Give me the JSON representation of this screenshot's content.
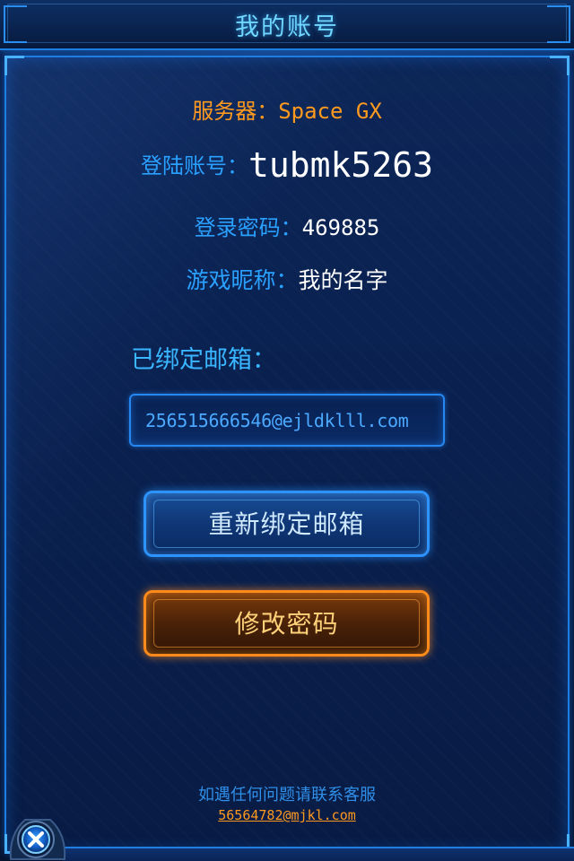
{
  "header": {
    "title": "我的账号"
  },
  "info": {
    "server_label": "服务器：",
    "server_value": "Space GX",
    "account_label": "登陆账号：",
    "account_value": "tubmk5263",
    "password_label": "登录密码：",
    "password_value": "469885",
    "nickname_label": "游戏昵称：",
    "nickname_value": "我的名字"
  },
  "email": {
    "label": "已绑定邮箱：",
    "value": "256515666546@ejldklll.com"
  },
  "buttons": {
    "rebind_label": "重新绑定邮箱",
    "change_password_label": "修改密码"
  },
  "footer": {
    "help_text": "如遇任何问题请联系客服",
    "service_email": "56564782@mjkl.com"
  },
  "icons": {
    "close": "close-x-icon"
  },
  "colors": {
    "accent_blue": "#2aa0ff",
    "accent_orange": "#ff9a1f",
    "background": "#0a2150"
  }
}
